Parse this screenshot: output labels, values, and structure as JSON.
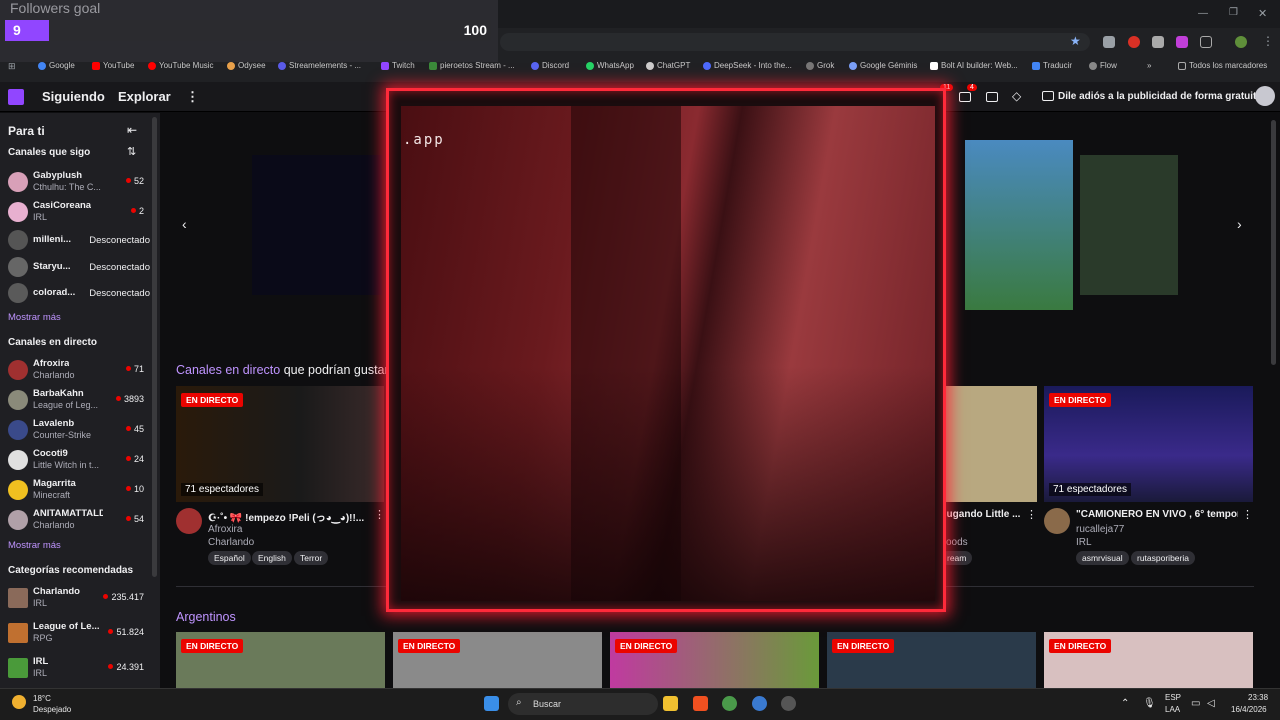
{
  "overlay": {
    "title": "Followers goal",
    "current": "9",
    "goal": "100",
    "progress_fraction": 0.09
  },
  "browser": {
    "bookmarks": [
      "Google",
      "YouTube",
      "YouTube Music",
      "Odysee",
      "Streamelements - ...",
      "Twitch",
      "pieroetos Stream - ...",
      "Discord",
      "WhatsApp",
      "ChatGPT",
      "DeepSeek - Into the...",
      "Grok",
      "Google Géminis",
      "Bolt AI builder: Web...",
      "Traducir",
      "Flow"
    ],
    "all_bookmarks": "Todos los marcadores",
    "overflow": "»"
  },
  "twitch_header": {
    "following": "Siguiendo",
    "explore": "Explorar",
    "more": "⋮",
    "notif_count_1": "11",
    "notif_count_2": "4",
    "ad_text": "Dile adiós a la publicidad de forma gratuita"
  },
  "sidebar": {
    "for_you": "Para ti",
    "followed_header": "Canales que sigo",
    "followed": [
      {
        "name": "Gabyplush",
        "sub": "Cthulhu: The C...",
        "viewers": "52"
      },
      {
        "name": "CasiCoreana",
        "sub": "IRL",
        "viewers": "2"
      },
      {
        "name": "milleni...",
        "status": "Desconectado"
      },
      {
        "name": "Staryu...",
        "status": "Desconectado"
      },
      {
        "name": "colorad...",
        "status": "Desconectado"
      }
    ],
    "show_more": "Mostrar más",
    "live_header": "Canales en directo",
    "live": [
      {
        "name": "Afroxira",
        "sub": "Charlando",
        "viewers": "71"
      },
      {
        "name": "BarbaKahn",
        "sub": "League of Leg...",
        "viewers": "3893"
      },
      {
        "name": "Lavalenb",
        "sub": "Counter-Strike",
        "viewers": "45"
      },
      {
        "name": "Cocoti9",
        "sub": "Little Witch in t...",
        "viewers": "24"
      },
      {
        "name": "Magarrita",
        "sub": "Minecraft",
        "viewers": "10"
      },
      {
        "name": "ANITAMATTALDI",
        "sub": "Charlando",
        "viewers": "54"
      }
    ],
    "show_more_2": "Mostrar más",
    "categories_header": "Categorías recomendadas",
    "categories": [
      {
        "name": "Charlando",
        "sub": "IRL",
        "viewers": "235.417"
      },
      {
        "name": "League of Le...",
        "sub": "RPG",
        "viewers": "51.824"
      },
      {
        "name": "IRL",
        "sub": "IRL",
        "viewers": "24.391"
      }
    ]
  },
  "main": {
    "section1_link": "Canales en directo",
    "section1_rest": "que podrían gustar",
    "live_badge": "EN DIRECTO",
    "card1": {
      "viewers": "71 espectadores",
      "title": "☪·˚• 🎀 !empezo !Peli (っ◕‿◕)!!...",
      "channel": "Afroxira",
      "category": "Charlando",
      "tags": [
        "Español",
        "English",
        "Terror"
      ]
    },
    "card4": {
      "title": "Jugando Little ...",
      "line2": "oods",
      "tag": "ream"
    },
    "card5": {
      "viewers": "71 espectadores",
      "title": "\"CAMIONERO EN VIVO , 6° tempor...",
      "channel": "rucalleja77",
      "category": "IRL",
      "tags": [
        "asmrvisual",
        "rutasporiberia"
      ]
    },
    "section2": "Argentinos"
  },
  "webcam": {
    "text": ".app"
  },
  "taskbar": {
    "weather_temp": "18°C",
    "weather_desc": "Despejado",
    "search": "Buscar",
    "lang1": "ESP",
    "lang2": "LAA",
    "time": "23:38",
    "date": "16/4/2026"
  }
}
